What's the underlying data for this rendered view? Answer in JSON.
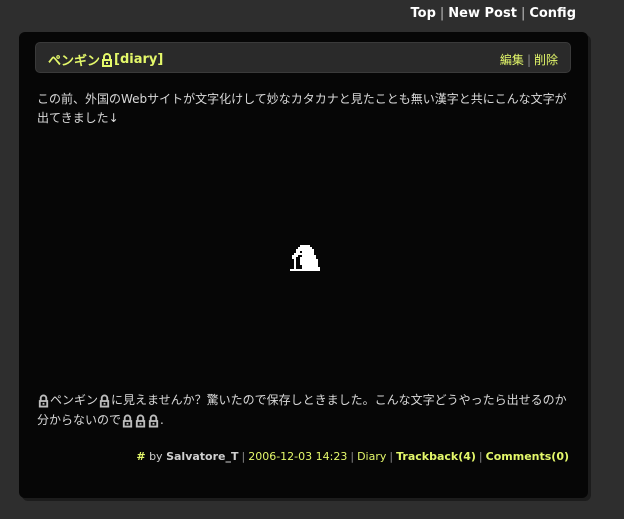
{
  "top_nav": {
    "top": "Top",
    "new_post": "New Post",
    "config": "Config",
    "separator": "|"
  },
  "post": {
    "title_prefix": "ペンギン",
    "title_suffix": "[diary]",
    "edit": "編集",
    "delete": "削除",
    "separator": "|",
    "paragraph1": "この前、外国のWebサイトが文字化けして妙なカタカナと見たことも無い漢字と共にこんな文字が出てきました↓",
    "paragraph2_a": "ペンギン",
    "paragraph2_b": "に見えませんか？驚いたので保存しときました。こんな文字どうやったら出せるのか分からないので",
    "paragraph2_c": ".",
    "meta": {
      "hash": "#",
      "by": " by ",
      "author": "Salvatore_T",
      "datetime": "2006-12-03 14:23",
      "category": "Diary",
      "trackback": "Trackback(4)",
      "comments": "Comments(0)",
      "separator": "|"
    }
  },
  "icons": {
    "inline_glyph": "penguin-lock-icon",
    "large_glyph": "penguin-image"
  },
  "colors": {
    "background": "#2e2e2e",
    "panel": "#060606",
    "accent": "#e4f86a",
    "text": "#d9d9d9"
  }
}
